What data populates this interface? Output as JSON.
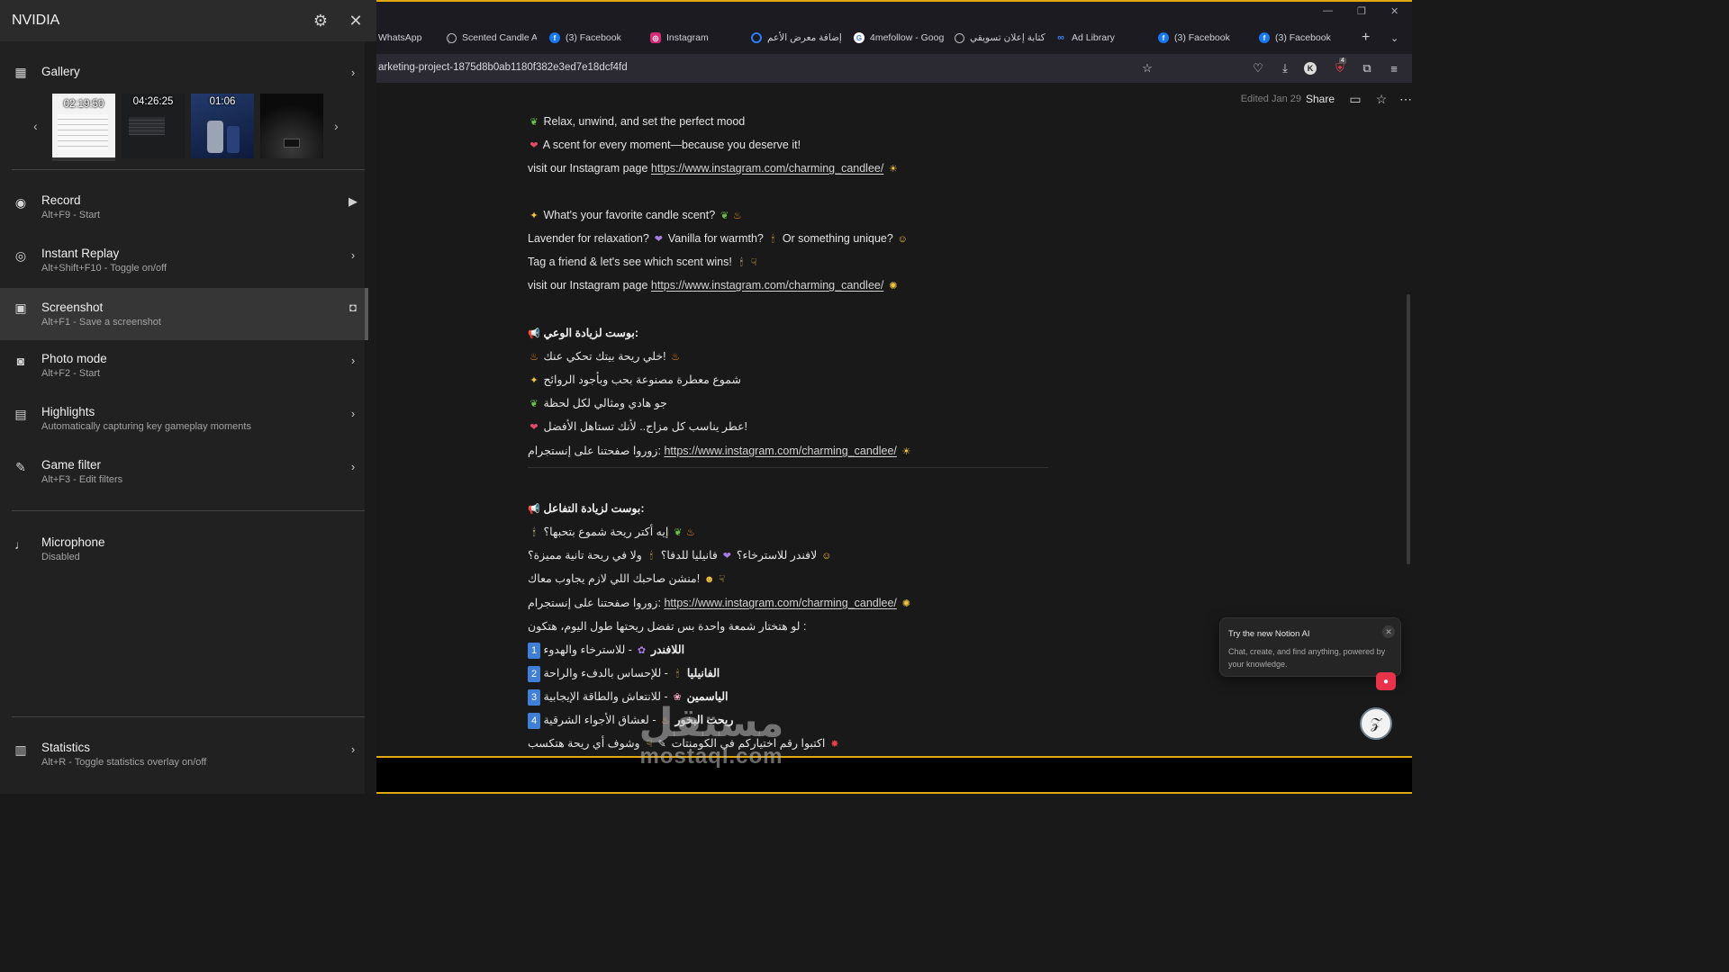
{
  "nvidia": {
    "title": "NVIDIA",
    "gallery": {
      "label": "Gallery",
      "thumbnails": [
        {
          "duration": "02:19:50"
        },
        {
          "duration": "04:26:25"
        },
        {
          "duration": "01:06"
        },
        {
          "duration": ""
        }
      ]
    },
    "items": [
      {
        "label": "Record",
        "shortcut": "Alt+F9 - Start"
      },
      {
        "label": "Instant Replay",
        "shortcut": "Alt+Shift+F10 - Toggle on/off"
      },
      {
        "label": "Screenshot",
        "shortcut": "Alt+F1 - Save a screenshot"
      },
      {
        "label": "Photo mode",
        "shortcut": "Alt+F2 - Start"
      },
      {
        "label": "Highlights",
        "shortcut": "Automatically capturing key gameplay moments"
      },
      {
        "label": "Game filter",
        "shortcut": "Alt+F3 - Edit filters"
      },
      {
        "label": "Microphone",
        "shortcut": "Disabled"
      },
      {
        "label": "Statistics",
        "shortcut": "Alt+R - Toggle statistics overlay on/off"
      }
    ]
  },
  "browser": {
    "tabs": [
      {
        "label": "WhatsApp",
        "icon": "whatsapp-icon"
      },
      {
        "label": "Scented Candle A",
        "icon": "chatgpt-icon"
      },
      {
        "label": "(3) Facebook",
        "icon": "facebook-icon"
      },
      {
        "label": "Instagram",
        "icon": "instagram-icon"
      },
      {
        "label": "إضافة معرض الأعم",
        "icon": "site-icon"
      },
      {
        "label": "4mefollow - Goog",
        "icon": "google-icon"
      },
      {
        "label": "كتابة إعلان تسويقي",
        "icon": "chatgpt-icon"
      },
      {
        "label": "Ad Library",
        "icon": "meta-icon"
      },
      {
        "label": "(3) Facebook",
        "icon": "facebook-icon"
      },
      {
        "label": "(3) Facebook",
        "icon": "facebook-icon"
      }
    ],
    "url": "arketing-project-1875d8b0ab1180f382e3ed7e18dcf4fd",
    "extension_badge": "4"
  },
  "notion": {
    "edited": "Edited Jan 29",
    "share": "Share",
    "link": "https://www.instagram.com/charming_candlee/",
    "lines": {
      "l1": "Relax, unwind, and set the perfect mood",
      "l2": "A scent for every moment—because you deserve it!",
      "l3_pre": "visit our Instagram page",
      "l4": "What's your favorite candle scent?",
      "l5a": "Lavender for relaxation?",
      "l5b": "Vanilla for warmth?",
      "l5c": "Or something unique?",
      "l6": "Tag a friend & let's see which scent wins!",
      "l7_pre": "visit our Instagram page",
      "h1": "بوست لزيادة الوعي:",
      "a1": "خلي ريحة بيتك تحكي عنك!",
      "a2": "شموع معطرة مصنوعة بحب وبأجود الروائح",
      "a3": "جو هادي ومثالي لكل لحظة",
      "a4": "عطر يناسب كل مزاج.. لأنك تستاهل الأفضل!",
      "a5_pre": "زوروا صفحتنا على إنستجرام:",
      "h2": "بوست لزيادة التفاعل:",
      "b1": "إيه أكتر ريحة شموع بتحبها؟",
      "b2a": "لافندر للاسترخاء؟",
      "b2b": "فانيليا للدفا؟",
      "b2c": "ولا في ريحة تانية مميزة؟",
      "b3": "منشن صاحبك اللي لازم يجاوب معاك!",
      "b4_pre": "زوروا صفحتنا على إنستجرام:",
      "b5": "لو هتختار شمعة واحدة بس تفضل ريحتها طول اليوم، هتكون :",
      "o1_name": "اللافندر",
      "o1_rest": "- للاسترخاء والهدوء",
      "o2_name": "الفانيليا",
      "o2_rest": "- للإحساس بالدفء والراحة",
      "o3_name": "الياسمين",
      "o3_rest": "- للانتعاش والطاقة الإيجابية",
      "o4_name": "ريحت البخور",
      "o4_rest": "- لعشاق الأجواء الشرقية",
      "b6": "اكتبوا رقم اختياركم في الكومنتات",
      "b6b": "وشوف أي ريحة هتكسب"
    },
    "toast": {
      "title": "Try the new Notion AI",
      "body": "Chat, create, and find anything, powered by your knowledge."
    }
  },
  "watermark": {
    "arabic": "مستقل",
    "latin": "mostaql.com"
  }
}
